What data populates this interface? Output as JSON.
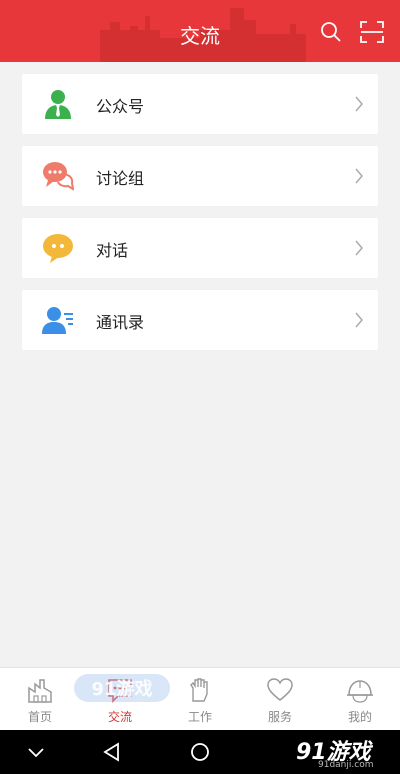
{
  "header": {
    "title": "交流",
    "bg_color": "#e8373a",
    "icons": [
      "search-icon",
      "scan-icon"
    ]
  },
  "menu": [
    {
      "label": "公众号",
      "icon": "official-account-icon",
      "color": "#3cb04c"
    },
    {
      "label": "讨论组",
      "icon": "discussion-group-icon",
      "color": "#ef7b6b"
    },
    {
      "label": "对话",
      "icon": "chat-bubble-icon",
      "color": "#f3b73a"
    },
    {
      "label": "通讯录",
      "icon": "contacts-icon",
      "color": "#3b8fe6"
    }
  ],
  "tabbar": {
    "active_color": "#d63535",
    "items": [
      {
        "label": "首页",
        "icon": "factory-icon"
      },
      {
        "label": "交流",
        "icon": "message-icon",
        "active": true
      },
      {
        "label": "工作",
        "icon": "glove-icon"
      },
      {
        "label": "服务",
        "icon": "heart-icon"
      },
      {
        "label": "我的",
        "icon": "helmet-icon"
      }
    ]
  },
  "watermark": {
    "text": "91游戏",
    "url": "91danji.com"
  },
  "system_nav": {
    "icons": [
      "down-chevron-icon",
      "back-icon",
      "home-icon"
    ]
  }
}
